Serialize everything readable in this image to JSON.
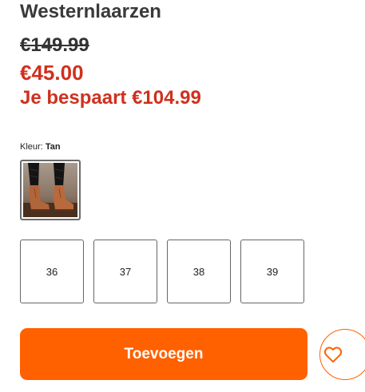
{
  "product": {
    "title": "Westernlaarzen",
    "old_price": "€149.99",
    "new_price": "€45.00",
    "savings": "Je bespaart €104.99"
  },
  "color": {
    "label": "Kleur:",
    "selected": "Tan"
  },
  "sizes": [
    "36",
    "37",
    "38",
    "39"
  ],
  "actions": {
    "add_label": "Toevoegen",
    "wishlist_icon": "heart-outline-icon"
  },
  "colors": {
    "accent": "#ff6100",
    "sale_red": "#d0301e"
  }
}
